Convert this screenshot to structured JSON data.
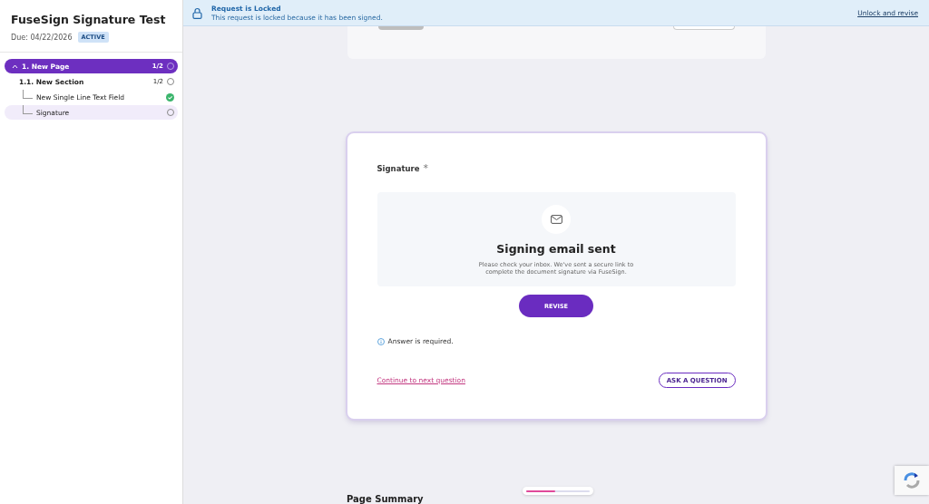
{
  "sidebar": {
    "title": "FuseSign Signature Test",
    "due": "Due: 04/22/2026",
    "status_badge": "ACTIVE",
    "tree": [
      {
        "label": "1. New Page",
        "count": "1/2",
        "expanded": true,
        "completed": false,
        "selected": false,
        "children": [
          {
            "label": "1.1. New Section",
            "count": "1/2",
            "completed": false,
            "selected": false,
            "children": [
              {
                "label": "New Single Line Text Field",
                "completed": true,
                "selected": false
              },
              {
                "label": "Signature",
                "completed": false,
                "selected": true
              }
            ]
          }
        ]
      }
    ]
  },
  "banner": {
    "title": "Request is Locked",
    "message": "This request is locked because it has been signed.",
    "action": "Unlock and revise"
  },
  "question": {
    "label": "Signature",
    "required_mark": "*",
    "status_title": "Signing email sent",
    "status_text": "Please check your inbox. We've sent a secure link to complete the document signature via FuseSign.",
    "revise_button": "REVISE",
    "hint": "Answer is required.",
    "continue_link": "Continue to next question",
    "ask_button": "ASK A QUESTION"
  },
  "footer": {
    "heading": "Page Summary",
    "progress": {
      "level": 0.45
    }
  }
}
